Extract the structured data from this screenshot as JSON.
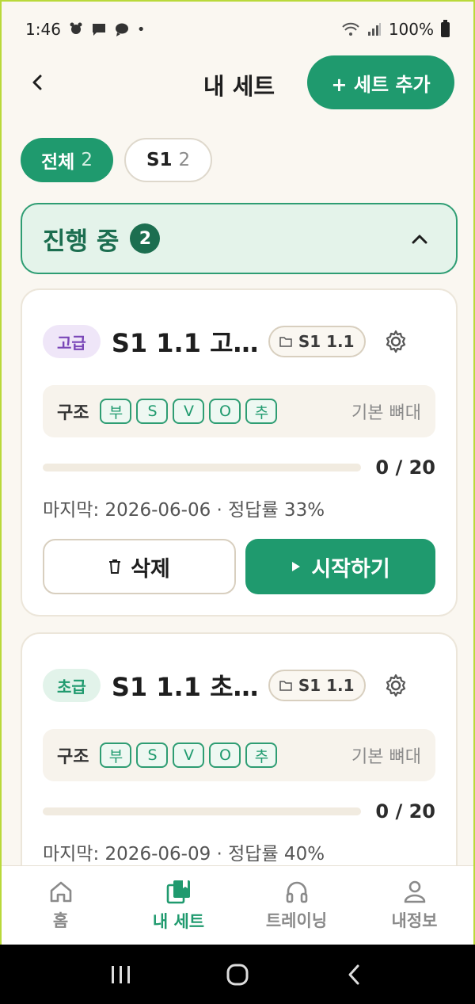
{
  "status_bar": {
    "time": "1:46",
    "battery": "100%"
  },
  "header": {
    "title": "내 세트",
    "add_button_label": "+ 세트 추가"
  },
  "filters": [
    {
      "label": "전체",
      "count": "2",
      "active": true
    },
    {
      "label": "S1",
      "count": "2",
      "active": false
    }
  ],
  "section": {
    "title": "진행 중",
    "count": "2"
  },
  "sets": [
    {
      "level": "고급",
      "title": "S1 1.1 고…",
      "folder": "S1 1.1",
      "structure_label": "구조",
      "tags": [
        "부",
        "S",
        "V",
        "O",
        "추"
      ],
      "structure_desc": "기본 뼈대",
      "progress_text": "0 / 20",
      "progress": 0,
      "meta": "마지막: 2026-06-06 · 정답률 33%",
      "delete_label": "삭제",
      "start_label": "시작하기"
    },
    {
      "level": "초급",
      "title": "S1 1.1 초…",
      "folder": "S1 1.1",
      "structure_label": "구조",
      "tags": [
        "부",
        "S",
        "V",
        "O",
        "추"
      ],
      "structure_desc": "기본 뼈대",
      "progress_text": "0 / 20",
      "progress": 0,
      "meta": "마지막: 2026-06-09 · 정답률 40%"
    }
  ],
  "bottom_nav": [
    {
      "label": "홈",
      "icon": "home-icon",
      "active": false
    },
    {
      "label": "내 세트",
      "icon": "sets-icon",
      "active": true
    },
    {
      "label": "트레이닝",
      "icon": "headphones-icon",
      "active": false
    },
    {
      "label": "내정보",
      "icon": "person-icon",
      "active": false
    }
  ],
  "colors": {
    "accent": "#1f9a6e",
    "background": "#faf7f1",
    "advanced": "#7a47b8"
  }
}
